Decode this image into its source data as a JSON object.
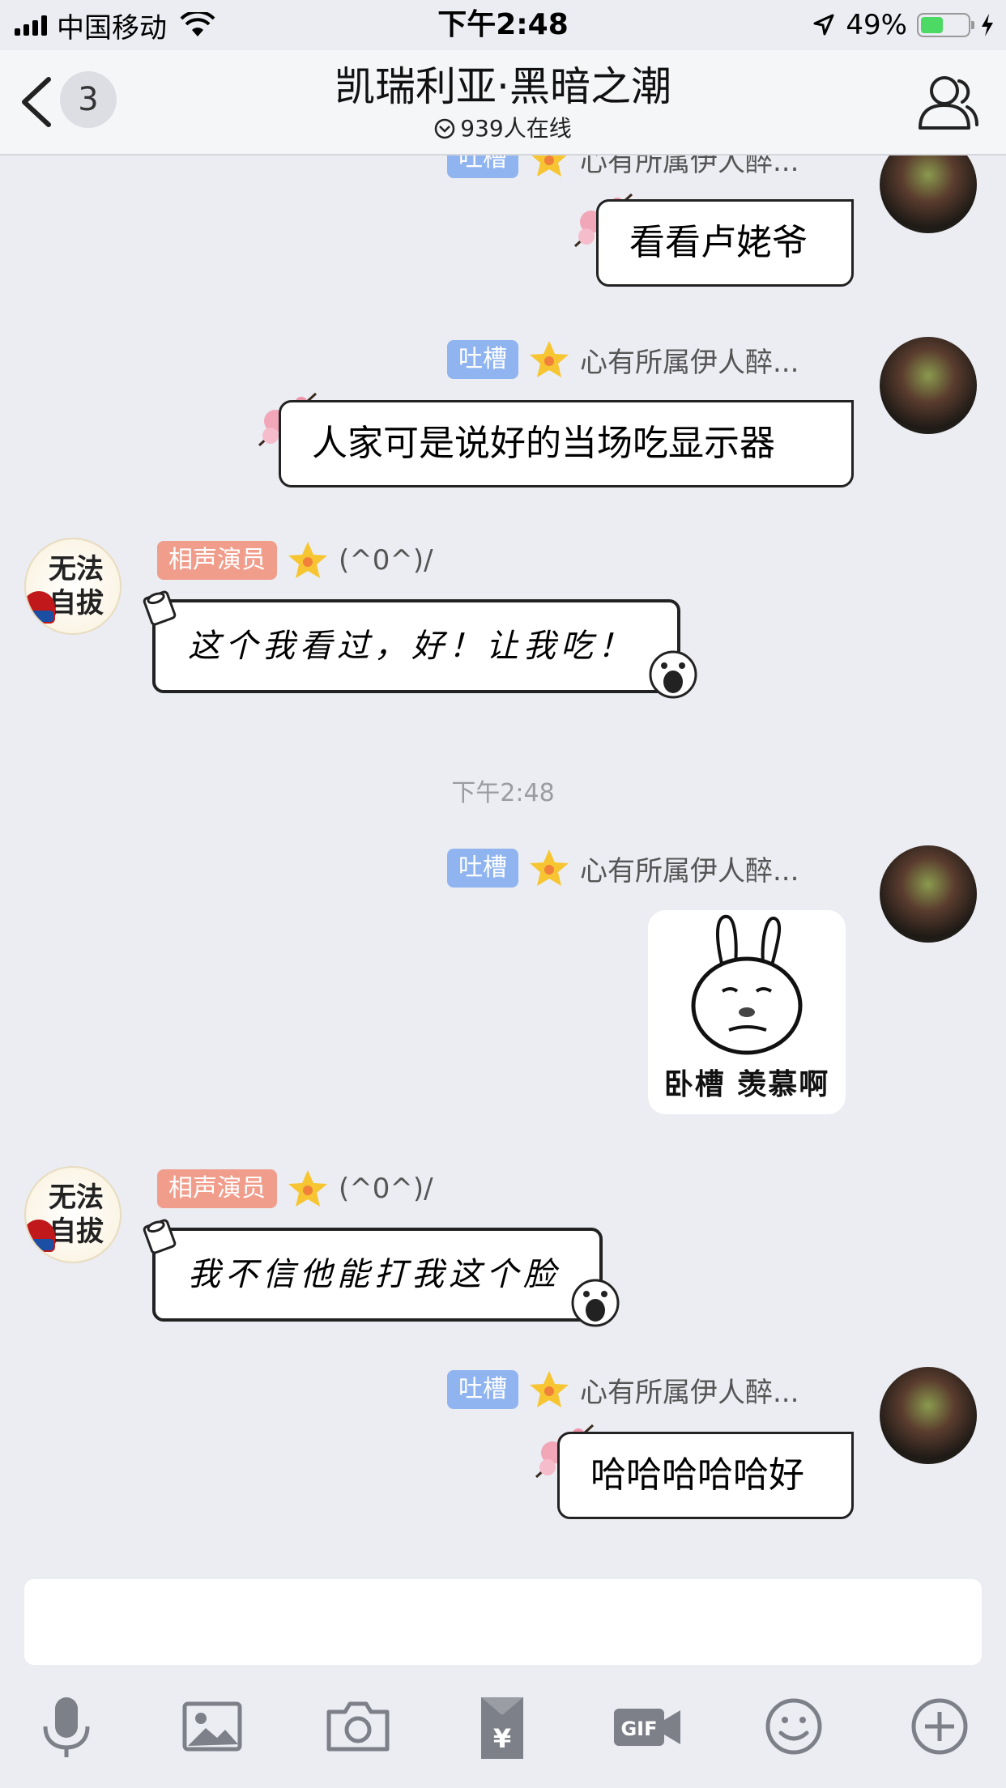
{
  "status": {
    "carrier": "中国移动",
    "time": "下午2:48",
    "battery": "49%",
    "battery_level": 0.49
  },
  "nav": {
    "unread_count": "3",
    "title": "凯瑞利亚·黑暗之潮",
    "online": "939人在线"
  },
  "messages": [
    {
      "tag": "吐槽",
      "name": "心有所属伊人醉...",
      "text": "看看卢姥爷"
    },
    {
      "tag": "吐槽",
      "name": "心有所属伊人醉...",
      "text": "人家可是说好的当场吃显示器"
    },
    {
      "tag": "相声演员",
      "name": "(^0^)/",
      "avatar_text": "无法自拔",
      "text": "这个我看过，好！让我吃！"
    },
    {
      "tag": "吐槽",
      "name": "心有所属伊人醉...",
      "sticker_caption": "卧槽 羡慕啊"
    },
    {
      "tag": "相声演员",
      "name": "(^0^)/",
      "avatar_text": "无法自拔",
      "text": "我不信他能打我这个脸"
    },
    {
      "tag": "吐槽",
      "name": "心有所属伊人醉...",
      "text": "哈哈哈哈哈好"
    }
  ],
  "time_separator": "下午2:48",
  "toolbar": {
    "icons": [
      "microphone-icon",
      "image-icon",
      "camera-icon",
      "red-packet-icon",
      "gif-icon",
      "emoji-icon",
      "plus-icon"
    ]
  },
  "colors": {
    "tag_blue": "#8fb4ef",
    "tag_red": "#f19d8c",
    "background": "#ebedf2"
  }
}
